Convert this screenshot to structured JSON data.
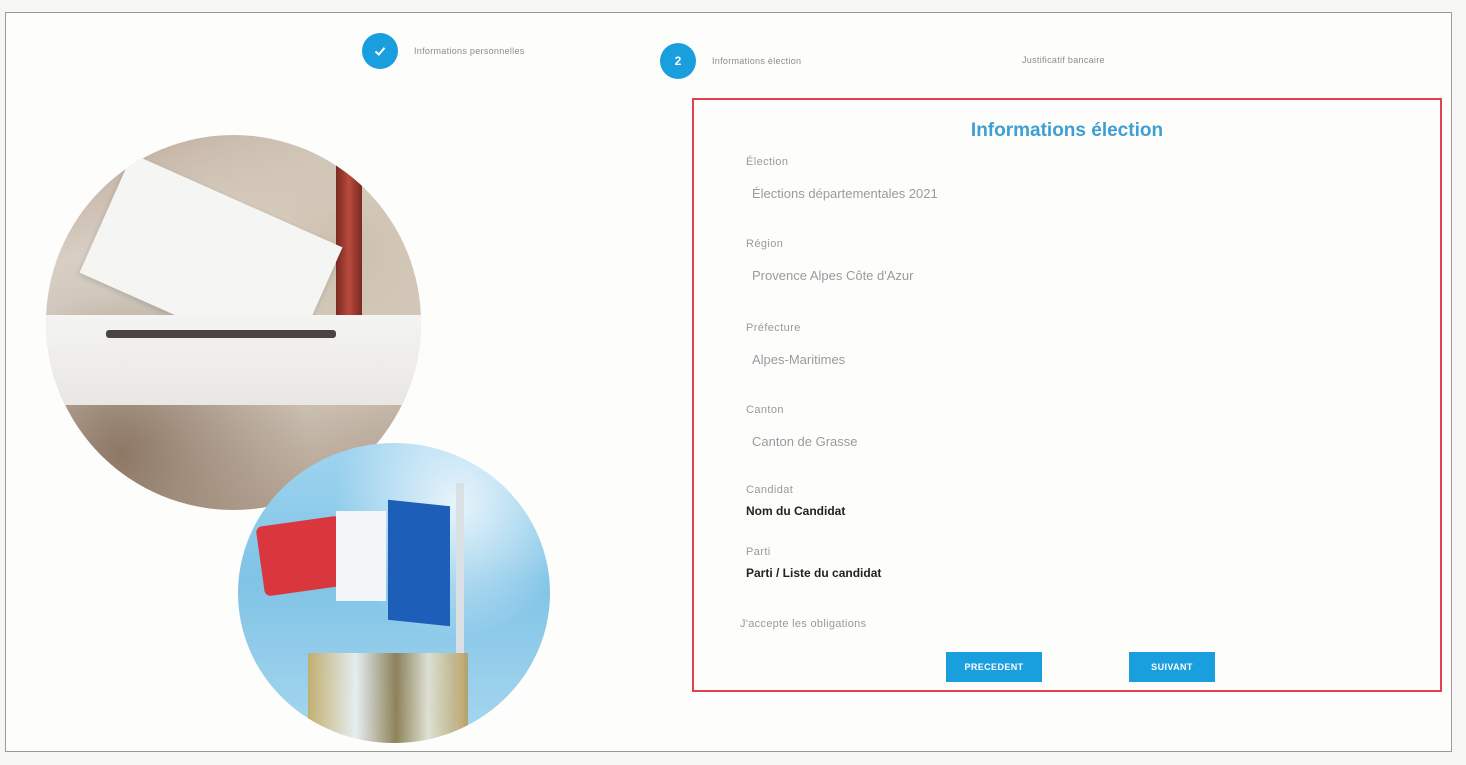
{
  "stepper": {
    "steps": [
      {
        "number": "",
        "icon": "check-icon",
        "label": "Informations personnelles",
        "state": "done"
      },
      {
        "number": "2",
        "label": "Informations élection",
        "state": "active"
      },
      {
        "number": "",
        "label": "Justificatif bancaire",
        "state": "pending"
      }
    ]
  },
  "form": {
    "title": "Informations élection",
    "fields": [
      {
        "label": "Élection",
        "value": "Élections départementales 2021"
      },
      {
        "label": "Région",
        "value": "Provence Alpes Côte d'Azur"
      },
      {
        "label": "Préfecture",
        "value": "Alpes-Maritimes"
      },
      {
        "label": "Canton",
        "value": "Canton de Grasse"
      },
      {
        "label": "Candidat",
        "value": "Nom du Candidat"
      },
      {
        "label": "Parti",
        "value": "Parti / Liste du candidat"
      }
    ],
    "checkbox_label": "J'accepte les obligations",
    "prev_label": "PRECEDENT",
    "next_label": "SUIVANT"
  },
  "colors": {
    "accent": "#1a9fde",
    "title": "#3d9fd2",
    "panel_border": "#e2414f"
  }
}
